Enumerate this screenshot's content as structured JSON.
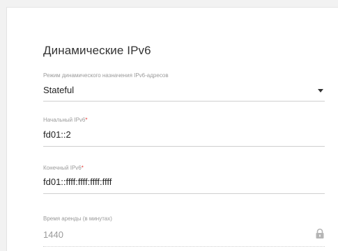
{
  "section": {
    "title": "Динамические IPv6"
  },
  "mode": {
    "label": "Режим динамического назначения IPv6-адресов",
    "value": "Stateful",
    "icon": "chevron-down-icon"
  },
  "start_ip": {
    "label": "Начальный IPv6",
    "required_mark": "*",
    "value": "fd01::2"
  },
  "end_ip": {
    "label": "Конечный IPv6",
    "required_mark": "*",
    "value": "fd01::ffff:ffff:ffff:ffff"
  },
  "lease": {
    "label": "Время аренды (в минутах)",
    "value": "1440",
    "icon": "lock-icon"
  },
  "colors": {
    "required": "#e53935",
    "label": "#9a9a9a",
    "text": "#222222"
  }
}
